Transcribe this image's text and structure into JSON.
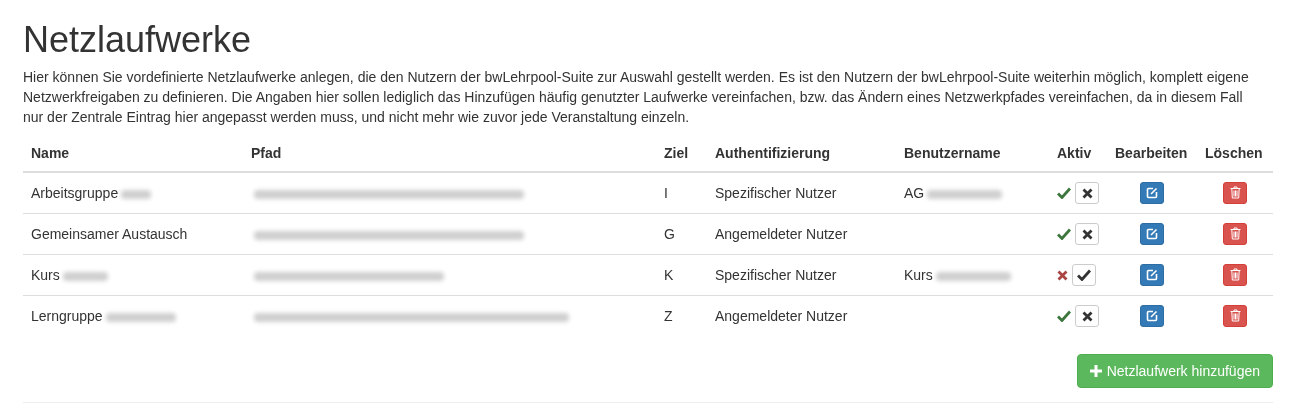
{
  "title": "Netzlaufwerke",
  "description": "Hier können Sie vordefinierte Netzlaufwerke anlegen, die den Nutzern der bwLehrpool-Suite zur Auswahl gestellt werden. Es ist den Nutzern der bwLehrpool-Suite weiterhin möglich, komplett eigene Netzwerkfreigaben zu definieren. Die Angaben hier sollen lediglich das Hinzufügen häufig genutzter Laufwerke vereinfachen, bzw. das Ändern eines Netzwerkpfades vereinfachen, da in diesem Fall nur der Zentrale Eintrag hier angepasst werden muss, und nicht mehr wie zuvor jede Veranstaltung einzeln.",
  "table": {
    "columns": [
      "Name",
      "Pfad",
      "Ziel",
      "Authentifizierung",
      "Benutzername",
      "Aktiv",
      "Bearbeiten",
      "Löschen"
    ],
    "rows": [
      {
        "name": "Arbeitsgruppe",
        "name_redacted": true,
        "path_redacted": true,
        "target": "I",
        "auth": "Spezifischer Nutzer",
        "username": "AG",
        "username_redacted": true,
        "active": true
      },
      {
        "name": "Gemeinsamer Austausch",
        "path_redacted": true,
        "target": "G",
        "auth": "Angemeldeter Nutzer",
        "active": true
      },
      {
        "name": "Kurs",
        "name_redacted": true,
        "path_redacted": true,
        "target": "K",
        "auth": "Spezifischer Nutzer",
        "username": "Kurs",
        "username_redacted": true,
        "active": false
      },
      {
        "name": "Lerngruppe",
        "name_redacted": true,
        "path_redacted": true,
        "target": "Z",
        "auth": "Angemeldeter Nutzer",
        "active": true
      }
    ]
  },
  "add_button": "Netzlaufwerk hinzufügen"
}
